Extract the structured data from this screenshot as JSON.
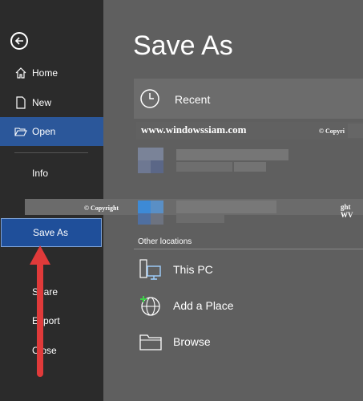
{
  "sidebar": {
    "items": [
      {
        "label": "Home",
        "icon": "home-icon"
      },
      {
        "label": "New",
        "icon": "new-document-icon"
      },
      {
        "label": "Open",
        "icon": "folder-open-icon"
      },
      {
        "label": "Info"
      },
      {
        "label": "Save As"
      },
      {
        "label": "Share"
      },
      {
        "label": "Export"
      },
      {
        "label": "Close"
      }
    ]
  },
  "main": {
    "title": "Save As",
    "recent_label": "Recent",
    "section_label": "Other locations",
    "locations": [
      {
        "label": "This PC",
        "icon": "this-pc-icon"
      },
      {
        "label": "Add a Place",
        "icon": "add-place-globe-icon"
      },
      {
        "label": "Browse",
        "icon": "browse-folder-icon"
      }
    ]
  },
  "watermark": {
    "site": "www.windowssiam.com",
    "copyright_left": "© Copyright",
    "copyright_right_fragment": "ght  WV",
    "copyright_top_right": "© Copyri"
  },
  "colors": {
    "sidebar_bg": "#2b2b2b",
    "main_bg": "#5f5f5f",
    "active_blue": "#2b579a",
    "arrow_red": "#e03a3a"
  }
}
